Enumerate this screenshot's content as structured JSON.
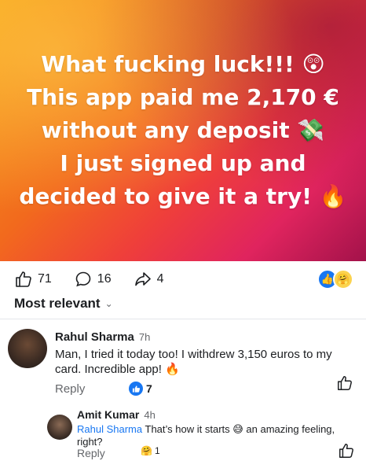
{
  "post": {
    "lines": [
      "What fucking luck!!! 😲",
      "This app paid me 2,170 €",
      "without any deposit 💸",
      "I just signed up and",
      "decided to give it a try! 🔥"
    ]
  },
  "actions": {
    "likes": "71",
    "comments": "16",
    "shares": "4"
  },
  "reactions": {
    "like": "👍",
    "care": "🤗"
  },
  "sort": {
    "label": "Most relevant"
  },
  "comments": [
    {
      "author": "Rahul Sharma",
      "time": "7h",
      "text": "Man, I tried it today too! I withdrew 3,150 euros to my card. Incredible app! 🔥",
      "reply_label": "Reply",
      "like_count": "7"
    },
    {
      "author": "Amit Kumar",
      "time": "4h",
      "mention": "Rahul Sharma",
      "text": "That’s how it starts 😅 an amazing feeling, right?",
      "reply_label": "Reply",
      "react_count": "1",
      "react_emoji": "🤗"
    }
  ],
  "colors": {
    "accent": "#1877f2",
    "muted": "#65676b"
  }
}
